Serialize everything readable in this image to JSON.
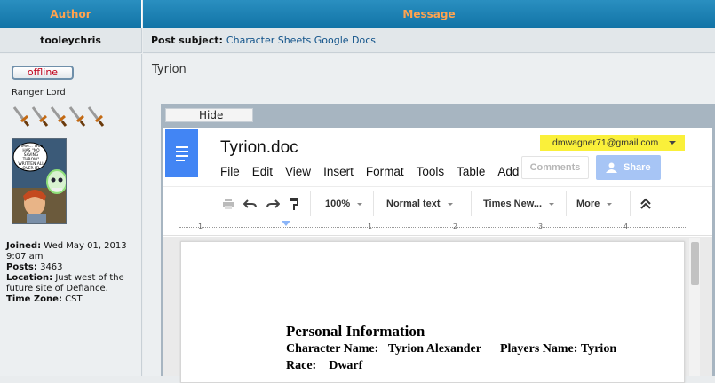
{
  "header": {
    "author_label": "Author",
    "message_label": "Message"
  },
  "post_meta": {
    "author_name": "tooleychris",
    "subject_label": "Post subject:",
    "subject_text": "Character Sheets Google Docs"
  },
  "profile": {
    "status": "offline",
    "rank": "Ranger Lord",
    "joined_label": "Joined:",
    "joined_value": "Wed May 01, 2013 9:07 am",
    "posts_label": "Posts:",
    "posts_value": "3463",
    "location_label": "Location:",
    "location_value": "Just west of the future site of Defiance.",
    "timezone_label": "Time Zone:",
    "timezone_value": "CST",
    "avatar_bubble": "HMM... THIS HAS \"NO SAVING THROW\" WRITTEN ALL OVER IT!"
  },
  "post": {
    "body_text": "Tyrion"
  },
  "embed": {
    "hide_label": "Hide"
  },
  "gdoc": {
    "title": "Tyrion.doc",
    "menu": [
      "File",
      "Edit",
      "View",
      "Insert",
      "Format",
      "Tools",
      "Table",
      "Add"
    ],
    "account_email": "dmwagner71@gmail.com",
    "comments_label": "Comments",
    "share_label": "Share",
    "toolbar": {
      "zoom": "100%",
      "style": "Normal text",
      "font": "Times New...",
      "more": "More"
    },
    "ruler_numbers": [
      "1",
      "1",
      "2",
      "3",
      "4"
    ],
    "doc": {
      "heading": "Personal Information",
      "line1_label": "Character Name:",
      "line1_value": "Tyrion Alexander",
      "line1_label2": "Players Name:",
      "line1_value2": "Tyrion",
      "line2_label": "Race:",
      "line2_value": "Dwarf"
    }
  },
  "colors": {
    "header_bg": "#1a7fb3",
    "header_text": "#ffa34f",
    "link": "#105289",
    "offline": "#c0001a",
    "docs_blue": "#4285f4",
    "account_highlight": "#faf03a"
  }
}
